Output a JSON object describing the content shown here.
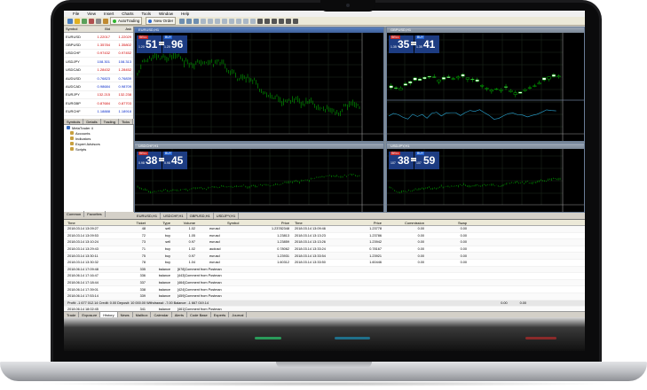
{
  "app": {
    "menu": [
      "File",
      "View",
      "Insert",
      "Charts",
      "Tools",
      "Window",
      "Help"
    ],
    "toolbar": {
      "autotrading_label": "AutoTrading",
      "new_order_label": "New Order"
    }
  },
  "market_watch": {
    "headers": [
      "Symbol",
      "Bid",
      "Ask"
    ],
    "rows": [
      {
        "symbol": "EURUSD",
        "bid": "1.22017",
        "ask": "1.22029",
        "dir": "dn"
      },
      {
        "symbol": "GBPUSD",
        "bid": "1.35784",
        "ask": "1.35802",
        "dir": "dn"
      },
      {
        "symbol": "USDCHF",
        "bid": "0.97432",
        "ask": "0.97452",
        "dir": "dn"
      },
      {
        "symbol": "USDJPY",
        "bid": "108.301",
        "ask": "108.313",
        "dir": "up"
      },
      {
        "symbol": "USDCAD",
        "bid": "1.28432",
        "ask": "1.28452",
        "dir": "dn"
      },
      {
        "symbol": "AUDUSD",
        "bid": "0.76823",
        "ask": "0.76839",
        "dir": "up"
      },
      {
        "symbol": "AUDCAD",
        "bid": "0.98684",
        "ask": "0.98709",
        "dir": "up"
      },
      {
        "symbol": "EURJPY",
        "bid": "132.215",
        "ask": "132.238",
        "dir": "dn"
      },
      {
        "symbol": "EURGBP",
        "bid": "0.87684",
        "ask": "0.87703",
        "dir": "dn"
      },
      {
        "symbol": "EURCHF",
        "bid": "1.18888",
        "ask": "1.18918",
        "dir": "up"
      },
      {
        "symbol": "EURCAD",
        "bid": "1.57122",
        "ask": "1.57162",
        "dir": "dn"
      },
      {
        "symbol": "GBPJPY",
        "bid": "147.108",
        "ask": "147.138",
        "dir": "dn"
      }
    ],
    "tabs": [
      "Symbols",
      "Details",
      "Trading",
      "Ticks"
    ]
  },
  "navigator": {
    "items": [
      "MetaTrader 4",
      "Accounts",
      "Indicators",
      "Expert Advisors",
      "Scripts"
    ],
    "tabs": [
      "Common",
      "Favorites"
    ]
  },
  "charts": [
    {
      "title": "EURUSD,H1",
      "sell": "51",
      "sell_small": "1.20",
      "buy": "96",
      "buy_small": "1.20",
      "lot": "0.01",
      "active": true
    },
    {
      "title": "GBPUSD,H1",
      "sell": "35",
      "sell_small": "1.35",
      "buy": "41",
      "buy_small": "1.35",
      "lot": "0.01",
      "active": false,
      "indicator": "USDJPY,H1"
    },
    {
      "title": "USDCHF,H1",
      "sell": "38",
      "sell_small": "0.98",
      "buy": "45",
      "buy_small": "0.98",
      "lot": "0.01",
      "active": false
    },
    {
      "title": "USDJPY,H1",
      "sell": "38",
      "sell_small": "107",
      "buy": "59",
      "buy_small": "107",
      "lot": "0.01",
      "active": false
    }
  ],
  "chart_tabs": [
    "EURUSD,H1",
    "USDCHF,H1",
    "GBPUSD,H1",
    "USDJPY,H1"
  ],
  "terminal": {
    "headers": [
      "Time",
      "Ticket",
      "Type",
      "Volume",
      "Symbol",
      "Price",
      "Time",
      "Price",
      "Commission",
      "Swap"
    ],
    "trades": [
      {
        "time": "2018.03.14 13:09:27",
        "ticket": "48",
        "type": "sell",
        "vol": "1.02",
        "sym": "eurusd",
        "price": "1.23782348",
        "ctime": "2018.03.14 13:09:46",
        "cprice": "1.23778",
        "comm": "0.00",
        "swap": "0.00"
      },
      {
        "time": "2018.03.14 13:09:53",
        "ticket": "72",
        "type": "buy",
        "vol": "1.05",
        "sym": "eurusd",
        "price": "1.23813",
        "ctime": "2018.03.14 13:13:23",
        "cprice": "1.23786",
        "comm": "0.00",
        "swap": "0.00"
      },
      {
        "time": "2018.03.14 13:10:24",
        "ticket": "73",
        "type": "sell",
        "vol": "0.97",
        "sym": "eurusd",
        "price": "1.23859",
        "ctime": "2018.03.14 13:13:26",
        "cprice": "1.23942",
        "comm": "0.00",
        "swap": "0.00"
      },
      {
        "time": "2018.03.14 13:29:43",
        "ticket": "71",
        "type": "buy",
        "vol": "1.02",
        "sym": "audusd",
        "price": "0.78062",
        "ctime": "2018.03.14 13:33:24",
        "cprice": "0.78167",
        "comm": "0.00",
        "swap": "0.00"
      },
      {
        "time": "2018.03.14 13:30:11",
        "ticket": "75",
        "type": "buy",
        "vol": "0.97",
        "sym": "eurusd",
        "price": "1.23931",
        "ctime": "2018.03.14 13:33:54",
        "cprice": "1.23921",
        "comm": "0.00",
        "swap": "0.00"
      },
      {
        "time": "2018.03.14 13:30:32",
        "ticket": "78",
        "type": "buy",
        "vol": "1.04",
        "sym": "eurusd",
        "price": "1.60312",
        "ctime": "2018.03.14 13:33:50",
        "cprice": "1.60446",
        "comm": "0.00",
        "swap": "0.00"
      }
    ],
    "balances": [
      {
        "time": "2018.06.14 17:09:48",
        "ticket": "335",
        "type": "balance",
        "text": "[678]Comment from Postman"
      },
      {
        "time": "2018.06.14 17:16:47",
        "ticket": "336",
        "type": "balance",
        "text": "[443]Comment from Postman"
      },
      {
        "time": "2018.06.14 17:18:44",
        "ticket": "337",
        "type": "balance",
        "text": "[464]Comment from Postman"
      },
      {
        "time": "2018.06.14 17:39:01",
        "ticket": "338",
        "type": "balance",
        "text": "[424]Comment from Postman"
      },
      {
        "time": "2018.06.14 17:53:14",
        "ticket": "339",
        "type": "balance",
        "text": "[459]Comment from Postman"
      },
      {
        "time": "2018.06.14 17:57:15",
        "ticket": "340",
        "type": "balance",
        "text": "[460]Comment from Postman"
      },
      {
        "time": "2018.06.14 18:02:45",
        "ticket": "341",
        "type": "balance",
        "text": "[461]Comment from Postman"
      },
      {
        "time": "2018.06.14 18:25:15",
        "ticket": "342",
        "type": "balance",
        "text": "[462]Comment from Postman"
      },
      {
        "time": "2018.06.14 18:32:29",
        "ticket": "343",
        "type": "balance",
        "text": "[463]Comment from Postman"
      }
    ],
    "summary": "Profit: -1 677 012.14  Credit: 0.00  Deposit: 10 000.00  Withdrawal: -7.00  Balance: -1 667 019.14",
    "summary_comm": "0.00",
    "summary_swap": "0.00",
    "tabs": [
      "Trade",
      "Exposure",
      "History",
      "News",
      "Mailbox",
      "Calendar",
      "Alerts",
      "Code Base",
      "Experts",
      "Journal"
    ],
    "active_tab": "History"
  },
  "colors": {
    "up_candle": "#00c800",
    "down_candle": "#00a000",
    "trade_sell": "#c62828",
    "trade_buy": "#1f5fcf"
  }
}
